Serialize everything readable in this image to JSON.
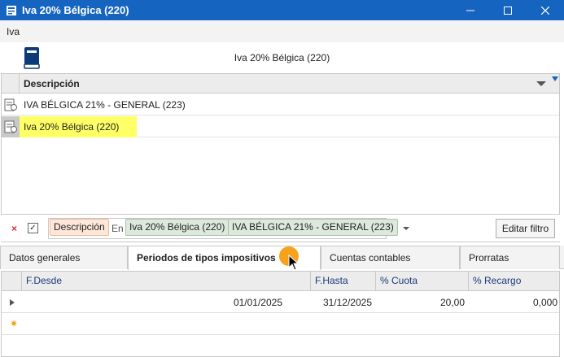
{
  "window": {
    "title": "Iva 20% Bélgica (220)"
  },
  "menu": {
    "items": [
      "Iva"
    ]
  },
  "header": {
    "title": "Iva 20% Bélgica (220)"
  },
  "list": {
    "column": "Descripción",
    "rows": [
      "IVA BÉLGICA 21% - GENERAL (223)",
      "Iva 20% Bélgica (220)"
    ],
    "selected_index": 1
  },
  "filter": {
    "field": "Descripción",
    "operator": "En",
    "values": [
      "Iva 20% Bélgica (220)",
      "IVA BÉLGICA 21% - GENERAL (223)"
    ],
    "edit_button": "Editar filtro",
    "clear_symbol": "×",
    "check_symbol": "✓"
  },
  "tabs": [
    "Datos generales",
    "Periodos de tipos impositivos",
    "Cuentas contables",
    "Prorratas"
  ],
  "active_tab": 1,
  "periods": {
    "columns": [
      "F.Desde",
      "F.Hasta",
      "% Cuota",
      "% Recargo"
    ],
    "rows": [
      {
        "desde": "01/01/2025",
        "hasta": "31/12/2025",
        "cuota": "20,00",
        "recargo": "0,000"
      }
    ],
    "new_row_symbol": "✷"
  },
  "colors": {
    "titlebar": "#1565c0",
    "highlight": "#ffff66",
    "cursor_halo": "#f6a21b"
  }
}
